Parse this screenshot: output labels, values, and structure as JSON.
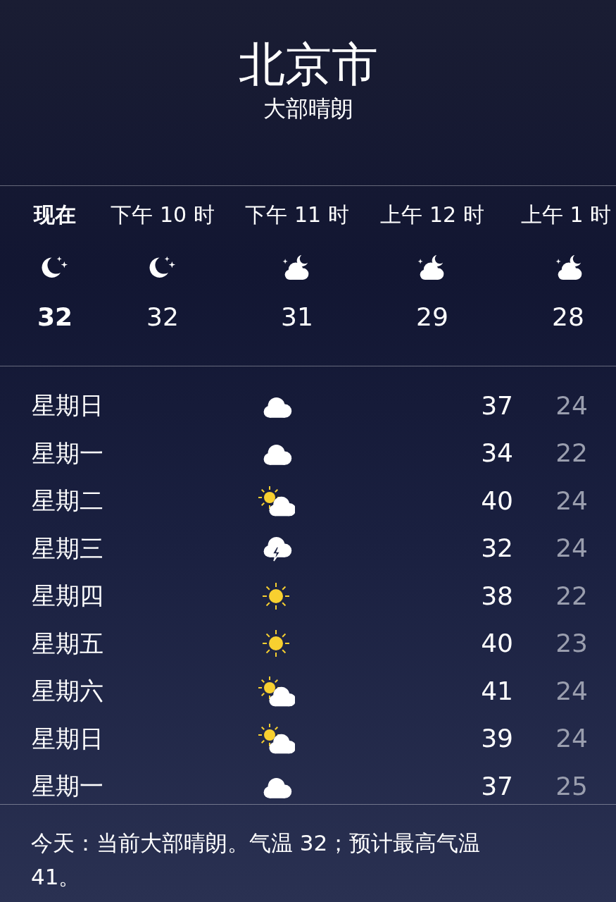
{
  "location": {
    "city": "北京市",
    "condition": "大部晴朗"
  },
  "hourly": [
    {
      "time": "现在",
      "kind": "moon",
      "temp": "32",
      "selected": true
    },
    {
      "time": "下午 10 时",
      "kind": "moon",
      "temp": "32",
      "selected": false
    },
    {
      "time": "下午 11 时",
      "kind": "night-cloud",
      "temp": "31",
      "selected": false
    },
    {
      "time": "上午 12 时",
      "kind": "night-cloud",
      "temp": "29",
      "selected": false
    },
    {
      "time": "上午 1 时",
      "kind": "night-cloud",
      "temp": "28",
      "selected": false
    }
  ],
  "daily": [
    {
      "day": "星期日",
      "kind": "cloud",
      "high": "37",
      "low": "24"
    },
    {
      "day": "星期一",
      "kind": "cloud",
      "high": "34",
      "low": "22"
    },
    {
      "day": "星期二",
      "kind": "partly-sunny",
      "high": "40",
      "low": "24"
    },
    {
      "day": "星期三",
      "kind": "thunder",
      "high": "32",
      "low": "24"
    },
    {
      "day": "星期四",
      "kind": "sun",
      "high": "38",
      "low": "22"
    },
    {
      "day": "星期五",
      "kind": "sun",
      "high": "40",
      "low": "23"
    },
    {
      "day": "星期六",
      "kind": "partly-sunny",
      "high": "41",
      "low": "24"
    },
    {
      "day": "星期日",
      "kind": "partly-sunny",
      "high": "39",
      "low": "24"
    },
    {
      "day": "星期一",
      "kind": "cloud",
      "high": "37",
      "low": "25"
    }
  ],
  "summary": "今天：当前大部晴朗。气温 32；预计最高气温 41。"
}
